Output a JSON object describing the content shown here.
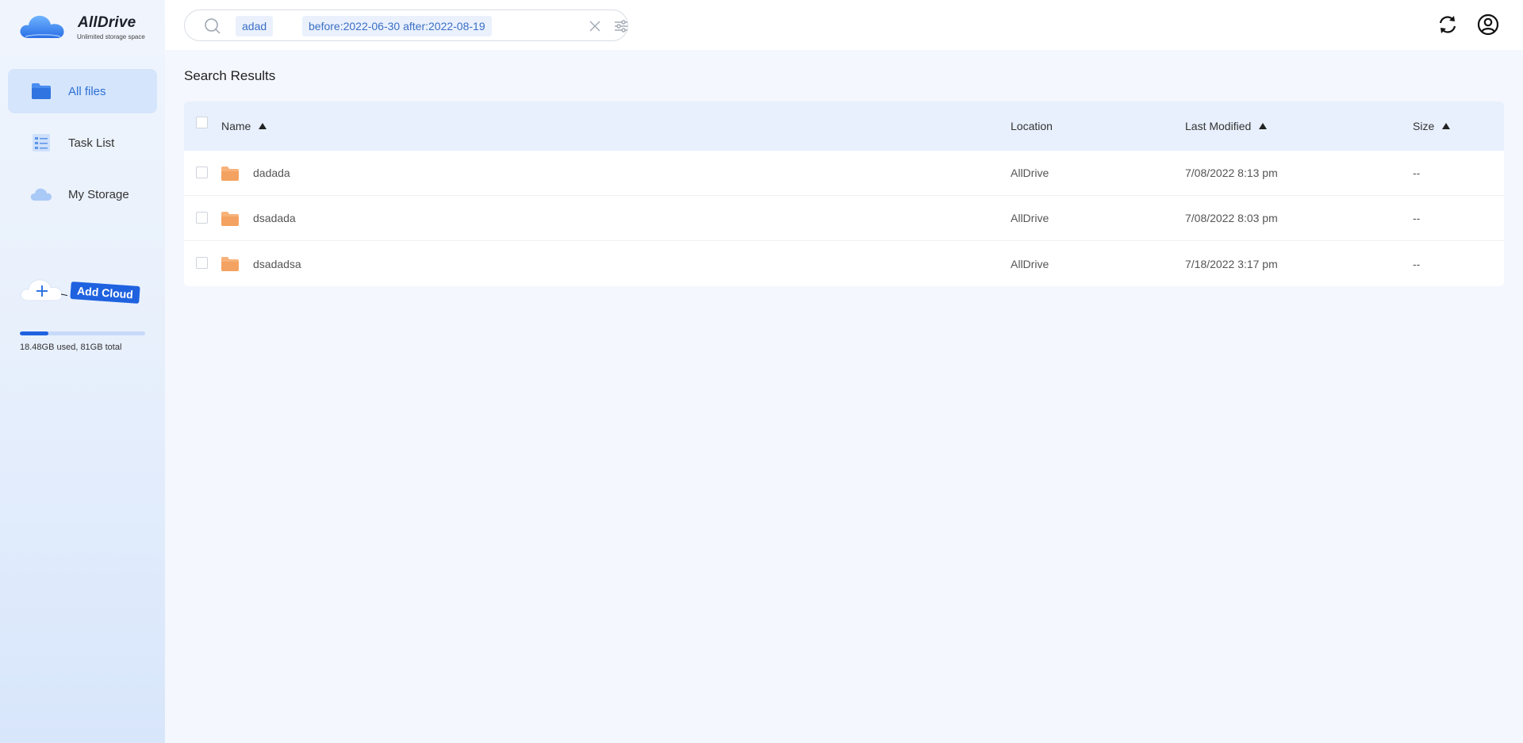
{
  "brand": {
    "name": "AllDrive",
    "tagline": "Unlimited storage space"
  },
  "sidebar": {
    "items": [
      {
        "label": "All files",
        "icon": "folder-icon",
        "active": true
      },
      {
        "label": "Task List",
        "icon": "task-list-icon",
        "active": false
      },
      {
        "label": "My Storage",
        "icon": "cloud-icon",
        "active": false
      }
    ],
    "add_cloud_label": "Add Cloud",
    "storage": {
      "used_fraction": 0.228,
      "text": "18.48GB used, 81GB total"
    }
  },
  "search": {
    "chips": [
      "adad",
      "before:2022-06-30 after:2022-08-19"
    ]
  },
  "main": {
    "title": "Search Results",
    "columns": {
      "name": "Name",
      "location": "Location",
      "modified": "Last Modified",
      "size": "Size"
    },
    "rows": [
      {
        "name": "dadada",
        "location": "AllDrive",
        "modified": "7/08/2022 8:13 pm",
        "size": "--"
      },
      {
        "name": "dsadada",
        "location": "AllDrive",
        "modified": "7/08/2022 8:03 pm",
        "size": "--"
      },
      {
        "name": "dsadadsa",
        "location": "AllDrive",
        "modified": "7/18/2022 3:17 pm",
        "size": "--"
      }
    ]
  },
  "colors": {
    "accent": "#1f62e0",
    "active_nav_bg": "#d5e5fb",
    "header_bg": "#e8f0fd",
    "folder": "#f4a261"
  }
}
